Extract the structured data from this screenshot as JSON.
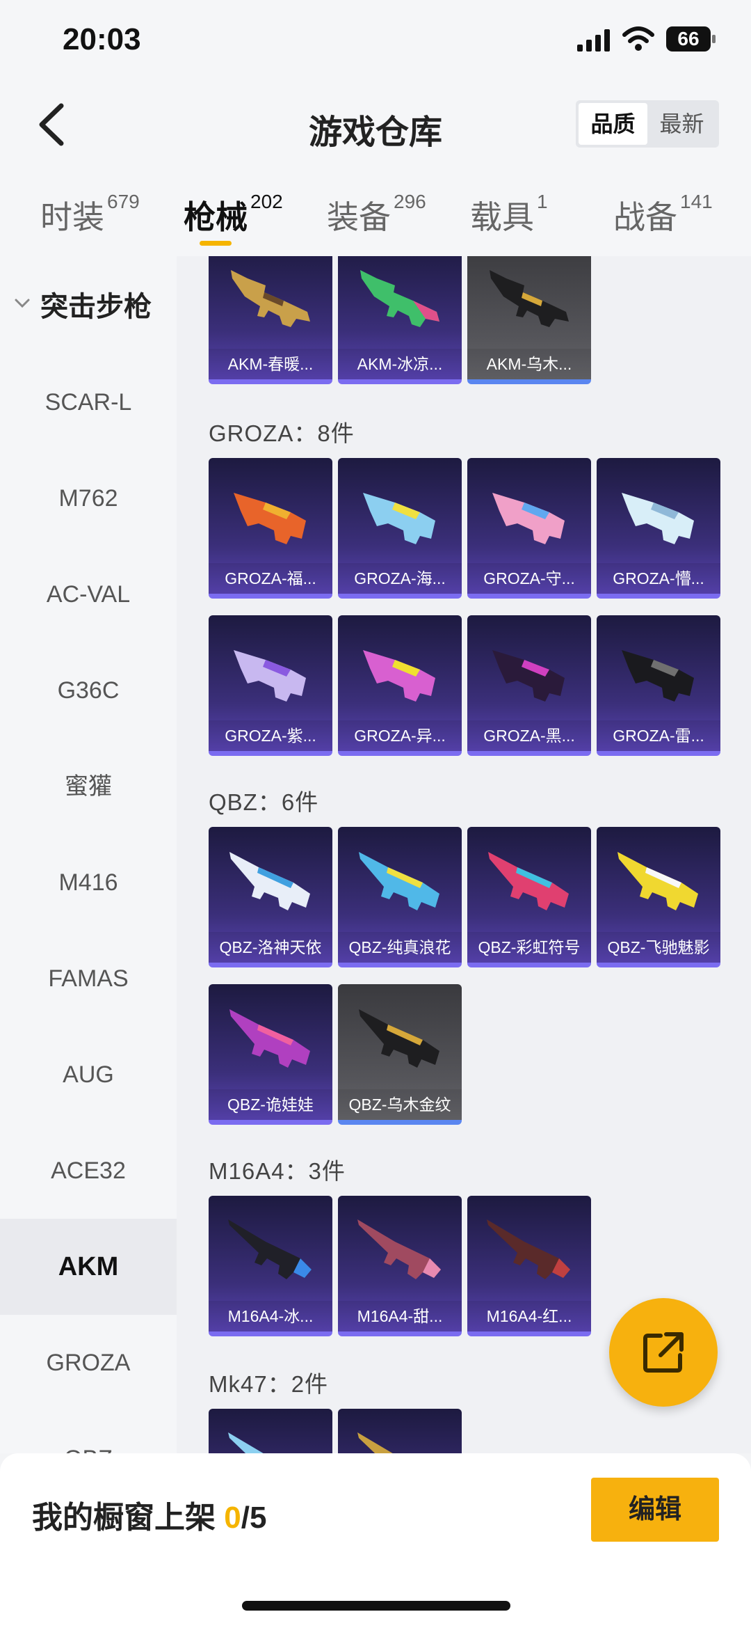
{
  "status": {
    "time": "20:03",
    "battery": "66"
  },
  "header": {
    "title": "游戏仓库",
    "sort_options": [
      "品质",
      "最新"
    ]
  },
  "tabs": [
    {
      "label": "时装",
      "count": "679"
    },
    {
      "label": "枪械",
      "count": "202"
    },
    {
      "label": "装备",
      "count": "296"
    },
    {
      "label": "载具",
      "count": "1"
    },
    {
      "label": "战备",
      "count": "141"
    }
  ],
  "sidebar": {
    "group": "突击步枪",
    "items": [
      "SCAR-L",
      "M762",
      "AC-VAL",
      "G36C",
      "蜜獾",
      "M416",
      "FAMAS",
      "AUG",
      "ACE32",
      "AKM",
      "GROZA",
      "QBZ"
    ]
  },
  "sections": {
    "akm": {
      "items": [
        "AKM-春暖...",
        "AKM-冰凉...",
        "AKM-乌木..."
      ]
    },
    "groza": {
      "label": "GROZA：8件",
      "items": [
        "GROZA-福...",
        "GROZA-海...",
        "GROZA-守...",
        "GROZA-懵...",
        "GROZA-紫...",
        "GROZA-异...",
        "GROZA-黑...",
        "GROZA-雷..."
      ]
    },
    "qbz": {
      "label": "QBZ：6件",
      "items": [
        "QBZ-洛神天依",
        "QBZ-纯真浪花",
        "QBZ-彩虹符号",
        "QBZ-飞驰魅影",
        "QBZ-诡娃娃",
        "QBZ-乌木金纹"
      ]
    },
    "m16a4": {
      "label": "M16A4：3件",
      "items": [
        "M16A4-冰...",
        "M16A4-甜...",
        "M16A4-红..."
      ]
    },
    "mk47": {
      "label": "Mk47：2件"
    }
  },
  "bottom": {
    "label": "我的橱窗上架",
    "current": "0",
    "total": "/5",
    "edit": "编辑"
  },
  "colors": {
    "accent": "#f7b10e",
    "card_purple": "#3b2f7a",
    "card_gray": "#55555a"
  }
}
